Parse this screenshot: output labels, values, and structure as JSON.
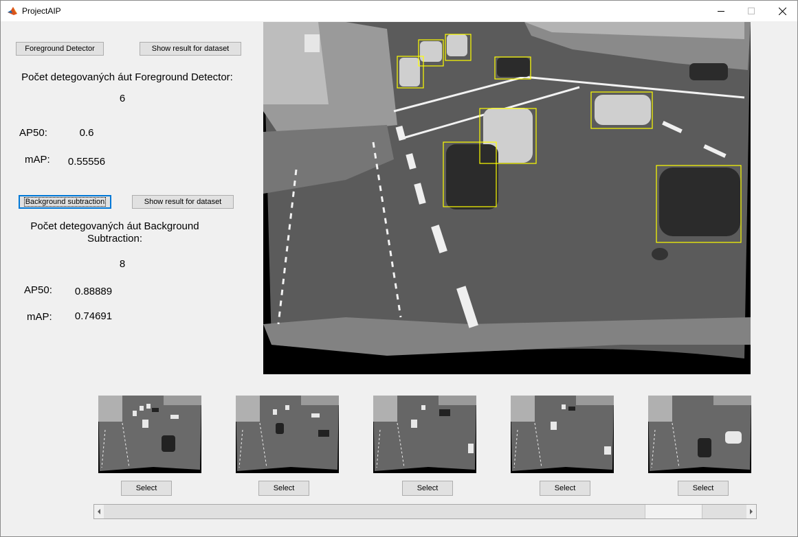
{
  "window": {
    "title": "ProjectAIP"
  },
  "foreground": {
    "button_label": "Foreground Detector",
    "show_label": "Show result for dataset",
    "count_label": "Počet detegovaných áut Foreground Detector:",
    "count_value": "6",
    "ap50_label": "AP50:",
    "ap50_value": "0.6",
    "map_label": "mAP:",
    "map_value": "0.55556"
  },
  "background": {
    "button_label": "Background subtraction",
    "show_label": "Show result for dataset",
    "count_label_line1": "Počet detegovaných áut Background",
    "count_label_line2": "Subtraction:",
    "count_value": "8",
    "ap50_label": "AP50:",
    "ap50_value": "0.88889",
    "map_label": "mAP:",
    "map_value": "0.74691"
  },
  "thumbnails": [
    {
      "select_label": "Select"
    },
    {
      "select_label": "Select"
    },
    {
      "select_label": "Select"
    },
    {
      "select_label": "Select"
    },
    {
      "select_label": "Select"
    }
  ],
  "colors": {
    "detection_box": "#ffff00",
    "focus_border": "#0078d7"
  },
  "scrollbar": {
    "position": 0.84
  }
}
